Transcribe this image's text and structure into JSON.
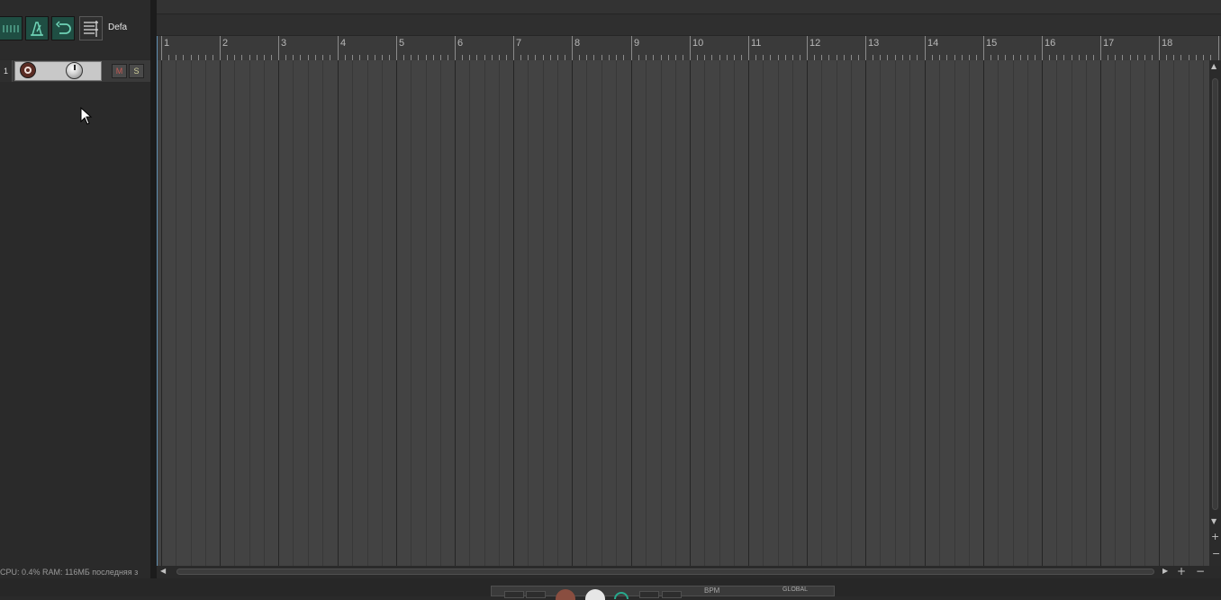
{
  "toolbar": {
    "layout_label": "Defa"
  },
  "track": {
    "number": "1",
    "mute_label": "M",
    "solo_label": "S"
  },
  "status": {
    "text": "CPU: 0.4%  RAM: 116МБ последняя з"
  },
  "ruler": {
    "bars": [
      "1",
      "2",
      "3",
      "4",
      "5",
      "6",
      "7",
      "8",
      "9",
      "10",
      "11",
      "12",
      "13",
      "14",
      "15",
      "16",
      "17",
      "18",
      "1"
    ]
  },
  "transport": {
    "bpm_label": "BPM",
    "global_label": "GLOBAL"
  },
  "colors": {
    "accent": "#1f4e43",
    "arrange_bg": "#434343",
    "playhead": "#5f8fb2"
  }
}
